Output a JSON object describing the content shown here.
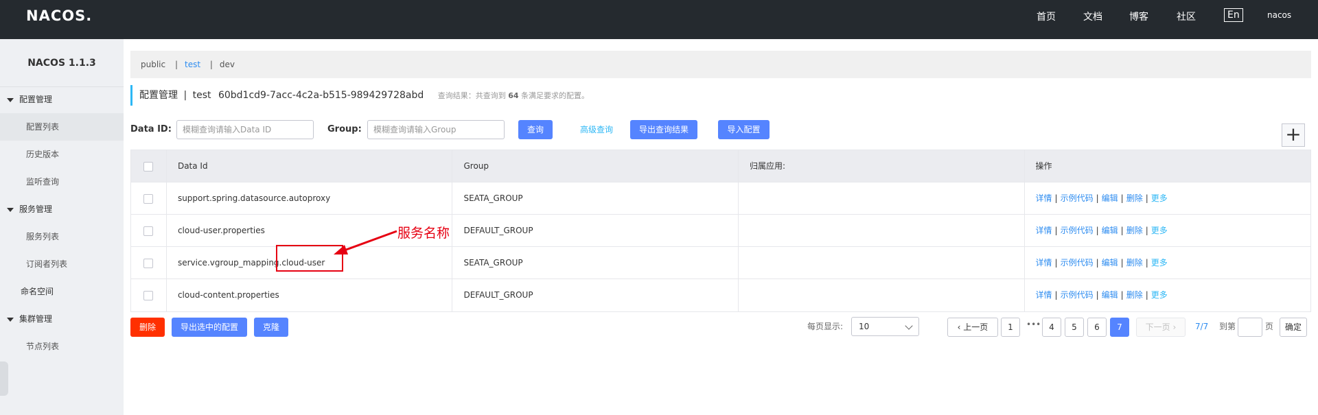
{
  "topbar": {
    "logo": "NACOS.",
    "nav": [
      "首页",
      "文档",
      "博客",
      "社区"
    ],
    "lang": "En",
    "user": "nacos"
  },
  "sidebar": {
    "title": "NACOS 1.1.3",
    "groups": [
      {
        "label": "配置管理",
        "items": [
          "配置列表",
          "历史版本",
          "监听查询"
        ]
      },
      {
        "label": "服务管理",
        "items": [
          "服务列表",
          "订阅者列表"
        ]
      },
      {
        "label": "命名空间"
      },
      {
        "label": "集群管理",
        "items": [
          "节点列表"
        ]
      }
    ]
  },
  "namespaces": [
    "public",
    "test",
    "dev"
  ],
  "namespace_seps": [
    "|",
    "|"
  ],
  "header": {
    "title": "配置管理",
    "sep": "|",
    "ns_name": "test",
    "ns_id": "60bd1cd9-7acc-4c2a-b515-989429728abd",
    "query_prefix": "查询结果：共查询到",
    "query_count": "64",
    "query_suffix": "条满足要求的配置。"
  },
  "search": {
    "data_id_label": "Data ID:",
    "data_id_placeholder": "模糊查询请输入Data ID",
    "group_label": "Group:",
    "group_placeholder": "模糊查询请输入Group",
    "query_btn": "查询",
    "advanced": "高级查询",
    "export_btn": "导出查询结果",
    "import_btn": "导入配置",
    "add_btn": "+"
  },
  "table": {
    "headers": [
      "Data Id",
      "Group",
      "归属应用:",
      "操作"
    ],
    "rows": [
      {
        "data_id": "support.spring.datasource.autoproxy",
        "group": "SEATA_GROUP",
        "app": ""
      },
      {
        "data_id": "cloud-user.properties",
        "group": "DEFAULT_GROUP",
        "app": ""
      },
      {
        "data_id": "service.vgroup_mapping.cloud-user",
        "group": "SEATA_GROUP",
        "app": ""
      },
      {
        "data_id": "cloud-content.properties",
        "group": "DEFAULT_GROUP",
        "app": ""
      }
    ],
    "ops": [
      "详情",
      "示例代码",
      "编辑",
      "删除",
      "更多"
    ]
  },
  "annotation": "服务名称",
  "footer": {
    "delete_btn": "删除",
    "export_selected_btn": "导出选中的配置",
    "clone_btn": "克隆",
    "page_size_label": "每页显示:",
    "page_size": "10",
    "prev": "上一页",
    "pages": [
      "1",
      "4",
      "5",
      "6",
      "7"
    ],
    "dots": "•••",
    "next": "下一页",
    "current_page": "7",
    "page_info": "7/7",
    "goto_label": "到第",
    "goto_unit": "页",
    "confirm": "确定"
  },
  "colors": {
    "topbar": "#252a2f",
    "primary": "#5584ff",
    "danger": "#ff3000",
    "link": "#2d8cf0",
    "annotation": "#e60012"
  }
}
